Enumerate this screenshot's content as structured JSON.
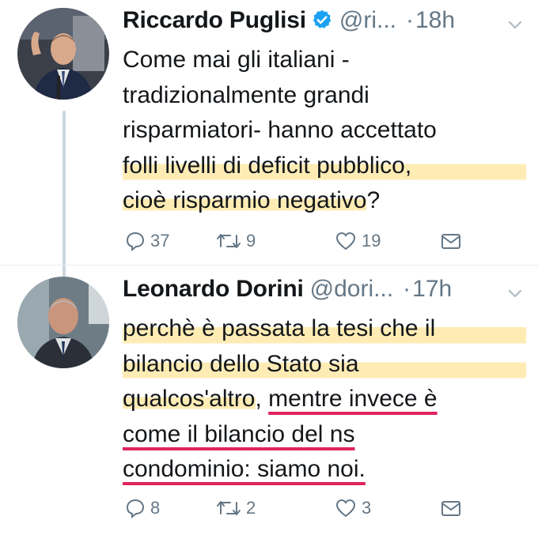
{
  "tweets": [
    {
      "author": "Riccardo Puglisi",
      "handle": "@ri...",
      "dot": "·",
      "time": "18h",
      "verified": true,
      "lines": [
        "Come mai gli italiani -",
        "tradizionalmente grandi",
        "risparmiatori- hanno accettato",
        "folli livelli di deficit pubblico,",
        "cioè risparmio negativo?"
      ],
      "replies": "37",
      "retweets": "9",
      "likes": "19"
    },
    {
      "author": "Leonardo Dorini",
      "handle": "@dori...",
      "dot": "·",
      "time": "17h",
      "verified": false,
      "lines": [
        "perchè è passata la tesi che il",
        "bilancio dello Stato sia",
        "qualcos'altro, mentre invece è",
        "come il bilancio del ns",
        "condominio: siamo noi."
      ],
      "replies": "8",
      "retweets": "2",
      "likes": "3"
    }
  ],
  "colors": {
    "text": "#14171a",
    "secondary": "#657786",
    "verified": "#1da1f2",
    "highlight": "#ffdc78",
    "underline": "#e0245e"
  },
  "icons": [
    "verified-badge-icon",
    "chevron-down-icon",
    "reply-icon",
    "retweet-icon",
    "like-icon",
    "direct-message-icon"
  ]
}
